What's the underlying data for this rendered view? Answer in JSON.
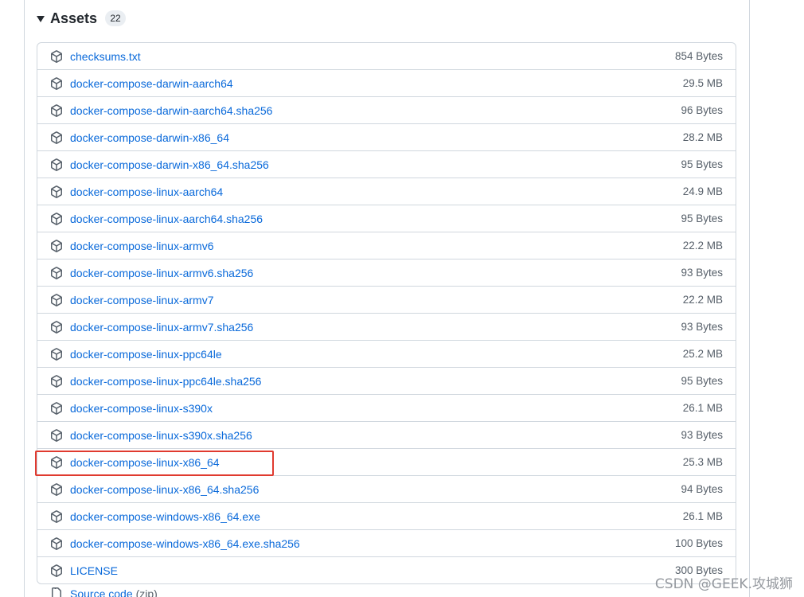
{
  "assets": {
    "title": "Assets",
    "count": "22",
    "items": [
      {
        "name": "checksums.txt",
        "size": "854 Bytes"
      },
      {
        "name": "docker-compose-darwin-aarch64",
        "size": "29.5 MB"
      },
      {
        "name": "docker-compose-darwin-aarch64.sha256",
        "size": "96 Bytes"
      },
      {
        "name": "docker-compose-darwin-x86_64",
        "size": "28.2 MB"
      },
      {
        "name": "docker-compose-darwin-x86_64.sha256",
        "size": "95 Bytes"
      },
      {
        "name": "docker-compose-linux-aarch64",
        "size": "24.9 MB"
      },
      {
        "name": "docker-compose-linux-aarch64.sha256",
        "size": "95 Bytes"
      },
      {
        "name": "docker-compose-linux-armv6",
        "size": "22.2 MB"
      },
      {
        "name": "docker-compose-linux-armv6.sha256",
        "size": "93 Bytes"
      },
      {
        "name": "docker-compose-linux-armv7",
        "size": "22.2 MB"
      },
      {
        "name": "docker-compose-linux-armv7.sha256",
        "size": "93 Bytes"
      },
      {
        "name": "docker-compose-linux-ppc64le",
        "size": "25.2 MB"
      },
      {
        "name": "docker-compose-linux-ppc64le.sha256",
        "size": "95 Bytes"
      },
      {
        "name": "docker-compose-linux-s390x",
        "size": "26.1 MB"
      },
      {
        "name": "docker-compose-linux-s390x.sha256",
        "size": "93 Bytes"
      },
      {
        "name": "docker-compose-linux-x86_64",
        "size": "25.3 MB"
      },
      {
        "name": "docker-compose-linux-x86_64.sha256",
        "size": "94 Bytes"
      },
      {
        "name": "docker-compose-windows-x86_64.exe",
        "size": "26.1 MB"
      },
      {
        "name": "docker-compose-windows-x86_64.exe.sha256",
        "size": "100 Bytes"
      },
      {
        "name": "LICENSE",
        "size": "300 Bytes"
      }
    ],
    "source_code": {
      "label": "Source code",
      "suffix": "(zip)"
    }
  },
  "watermark": "CSDN @GEEK.攻城狮",
  "colors": {
    "link": "#0969da",
    "highlight": "#e03a2f",
    "border": "#d0d7de"
  },
  "icons": {
    "asset": "package-icon",
    "toggle": "caret-down-icon",
    "source": "file-zip-icon"
  }
}
